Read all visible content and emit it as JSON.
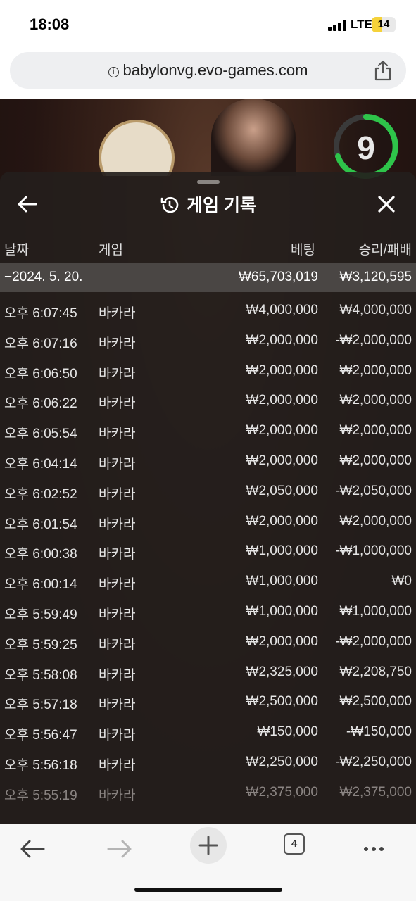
{
  "status": {
    "time": "18:08",
    "network": "LTE",
    "battery": "14"
  },
  "browser": {
    "url": "babylonvg.evo-games.com",
    "tab_count": "4"
  },
  "game": {
    "countdown": "9"
  },
  "panel": {
    "title": "게임 기록",
    "columns": {
      "date": "날짜",
      "game": "게임",
      "bet": "베팅",
      "winloss": "승리/패배"
    },
    "summary": {
      "date": "−2024. 5. 20.",
      "bet": "₩65,703,019",
      "winloss": "₩3,120,595"
    },
    "rows": [
      {
        "time": "오후 6:07:45",
        "game": "바카라",
        "bet": "₩4,000,000",
        "result": "₩4,000,000"
      },
      {
        "time": "오후 6:07:16",
        "game": "바카라",
        "bet": "₩2,000,000",
        "result": "-₩2,000,000"
      },
      {
        "time": "오후 6:06:50",
        "game": "바카라",
        "bet": "₩2,000,000",
        "result": "₩2,000,000"
      },
      {
        "time": "오후 6:06:22",
        "game": "바카라",
        "bet": "₩2,000,000",
        "result": "₩2,000,000"
      },
      {
        "time": "오후 6:05:54",
        "game": "바카라",
        "bet": "₩2,000,000",
        "result": "₩2,000,000"
      },
      {
        "time": "오후 6:04:14",
        "game": "바카라",
        "bet": "₩2,000,000",
        "result": "₩2,000,000"
      },
      {
        "time": "오후 6:02:52",
        "game": "바카라",
        "bet": "₩2,050,000",
        "result": "-₩2,050,000"
      },
      {
        "time": "오후 6:01:54",
        "game": "바카라",
        "bet": "₩2,000,000",
        "result": "₩2,000,000"
      },
      {
        "time": "오후 6:00:38",
        "game": "바카라",
        "bet": "₩1,000,000",
        "result": "-₩1,000,000"
      },
      {
        "time": "오후 6:00:14",
        "game": "바카라",
        "bet": "₩1,000,000",
        "result": "₩0"
      },
      {
        "time": "오후 5:59:49",
        "game": "바카라",
        "bet": "₩1,000,000",
        "result": "₩1,000,000"
      },
      {
        "time": "오후 5:59:25",
        "game": "바카라",
        "bet": "₩2,000,000",
        "result": "-₩2,000,000"
      },
      {
        "time": "오후 5:58:08",
        "game": "바카라",
        "bet": "₩2,325,000",
        "result": "₩2,208,750"
      },
      {
        "time": "오후 5:57:18",
        "game": "바카라",
        "bet": "₩2,500,000",
        "result": "₩2,500,000"
      },
      {
        "time": "오후 5:56:47",
        "game": "바카라",
        "bet": "₩150,000",
        "result": "-₩150,000"
      },
      {
        "time": "오후 5:56:18",
        "game": "바카라",
        "bet": "₩2,250,000",
        "result": "-₩2,250,000"
      },
      {
        "time": "오후 5:55:19",
        "game": "바카라",
        "bet": "₩2,375,000",
        "result": "₩2,375,000"
      }
    ]
  },
  "icons": [
    "info-icon",
    "share-icon",
    "back-arrow-icon",
    "history-icon",
    "close-icon",
    "browser-back-icon",
    "browser-forward-icon",
    "plus-icon",
    "tabs-icon",
    "more-icon"
  ]
}
